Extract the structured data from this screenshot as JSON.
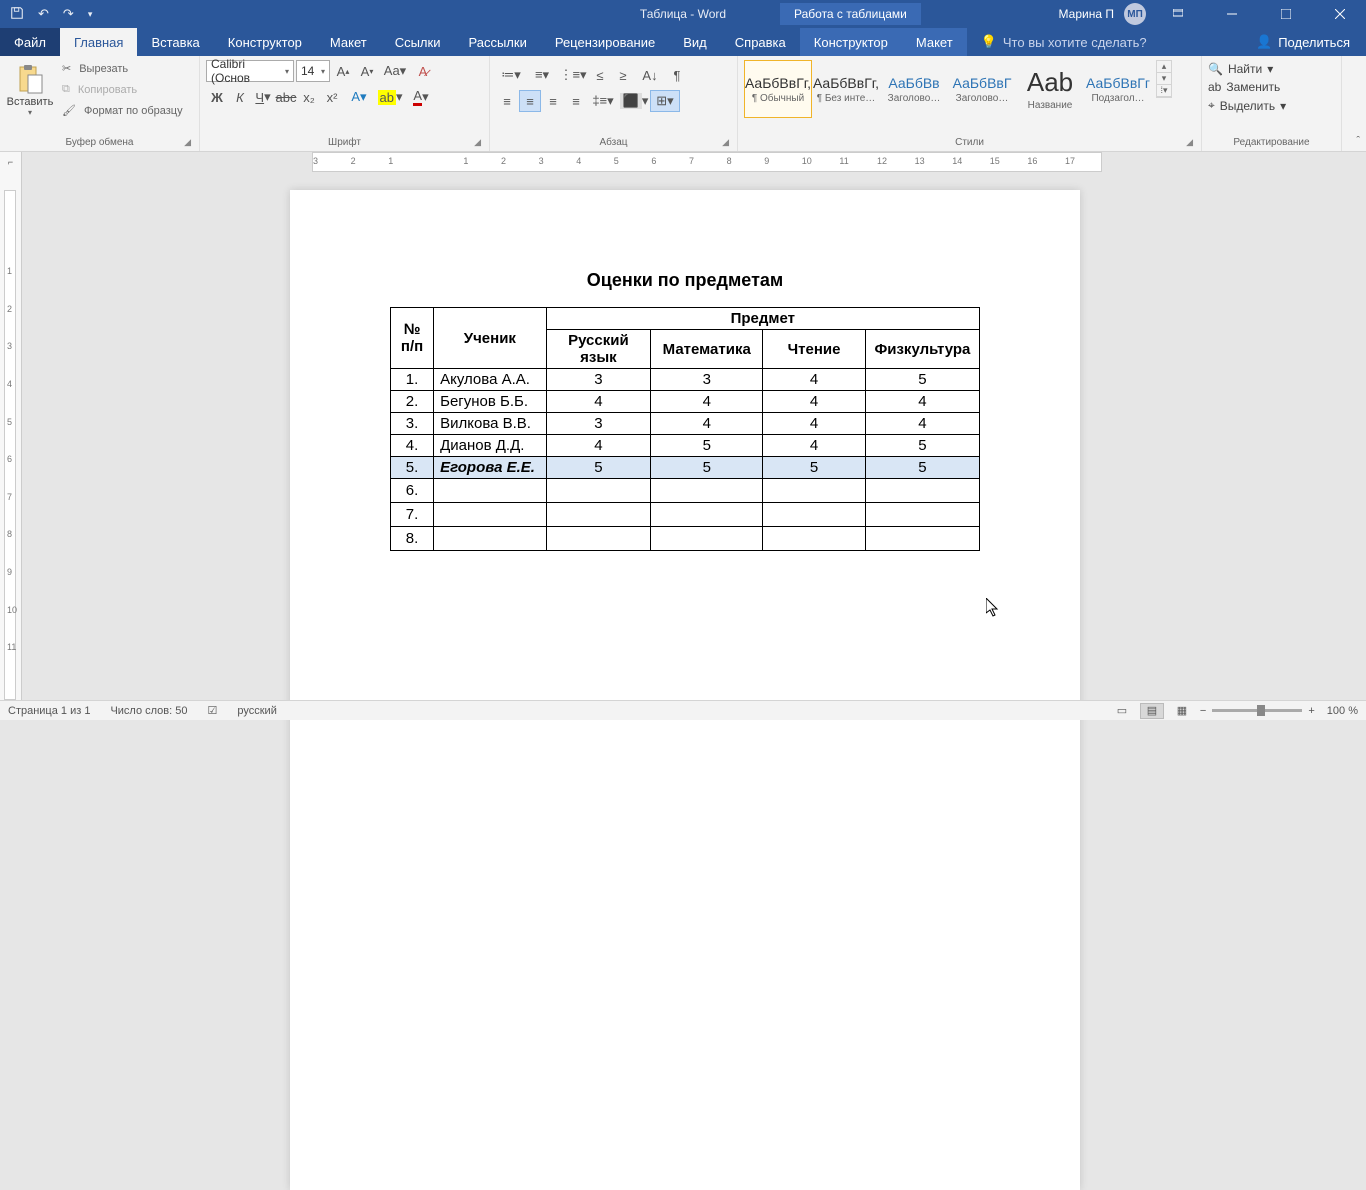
{
  "title": {
    "doc": "Таблица - Word",
    "tableTools": "Работа с таблицами",
    "user": "Марина П",
    "avatar": "МП"
  },
  "tabs": {
    "file": "Файл",
    "home": "Главная",
    "insert": "Вставка",
    "design": "Конструктор",
    "layout": "Макет",
    "references": "Ссылки",
    "mailings": "Рассылки",
    "review": "Рецензирование",
    "view": "Вид",
    "help": "Справка",
    "tableDesign": "Конструктор",
    "tableLayout": "Макет",
    "tellme": "Что вы хотите сделать?",
    "share": "Поделиться"
  },
  "ribbon": {
    "paste": "Вставить",
    "cut": "Вырезать",
    "copy": "Копировать",
    "formatPainter": "Формат по образцу",
    "clipboard": "Буфер обмена",
    "fontName": "Calibri (Основ",
    "fontSize": "14",
    "fontGroup": "Шрифт",
    "paraGroup": "Абзац",
    "styles": [
      {
        "prev": "АаБбВвГг,",
        "label": "¶ Обычный",
        "cls": "sel"
      },
      {
        "prev": "АаБбВвГг,",
        "label": "¶ Без инте…",
        "cls": ""
      },
      {
        "prev": "АаБбВв",
        "label": "Заголово…",
        "cls": "blue"
      },
      {
        "prev": "АаБбВвГ",
        "label": "Заголово…",
        "cls": "blue"
      },
      {
        "prev": "Aab",
        "label": "Название",
        "cls": "big"
      },
      {
        "prev": "АаБбВвГг",
        "label": "Подзагол…",
        "cls": "blue"
      }
    ],
    "stylesGroup": "Стили",
    "find": "Найти",
    "replace": "Заменить",
    "select": "Выделить",
    "editGroup": "Редактирование"
  },
  "doc": {
    "heading": "Оценки по предметам",
    "headers": {
      "num": "№ п/п",
      "student": "Ученик",
      "subject": "Предмет",
      "rus": "Русский язык",
      "math": "Математика",
      "read": "Чтение",
      "pe": "Физкультура"
    },
    "rows": [
      {
        "n": "1.",
        "name": "Акулова А.А.",
        "rus": "3",
        "math": "3",
        "read": "4",
        "pe": "5",
        "hl": false
      },
      {
        "n": "2.",
        "name": "Бегунов Б.Б.",
        "rus": "4",
        "math": "4",
        "read": "4",
        "pe": "4",
        "hl": false
      },
      {
        "n": "3.",
        "name": "Вилкова В.В.",
        "rus": "3",
        "math": "4",
        "read": "4",
        "pe": "4",
        "hl": false
      },
      {
        "n": "4.",
        "name": "Дианов Д.Д.",
        "rus": "4",
        "math": "5",
        "read": "4",
        "pe": "5",
        "hl": false
      },
      {
        "n": "5.",
        "name": "Егорова Е.Е.",
        "rus": "5",
        "math": "5",
        "read": "5",
        "pe": "5",
        "hl": true
      },
      {
        "n": "6.",
        "name": "",
        "rus": "",
        "math": "",
        "read": "",
        "pe": "",
        "hl": false
      },
      {
        "n": "7.",
        "name": "",
        "rus": "",
        "math": "",
        "read": "",
        "pe": "",
        "hl": false
      },
      {
        "n": "8.",
        "name": "",
        "rus": "",
        "math": "",
        "read": "",
        "pe": "",
        "hl": false
      }
    ]
  },
  "status": {
    "page": "Страница 1 из 1",
    "words": "Число слов: 50",
    "lang": "русский",
    "zoom": "100 %"
  },
  "ruler": {
    "h": [
      "3",
      "2",
      "1",
      "",
      "1",
      "2",
      "3",
      "4",
      "5",
      "6",
      "7",
      "8",
      "9",
      "10",
      "11",
      "12",
      "13",
      "14",
      "15",
      "16",
      "17"
    ],
    "v": [
      "",
      "",
      "1",
      "2",
      "3",
      "4",
      "5",
      "6",
      "7",
      "8",
      "9",
      "10",
      "11"
    ]
  }
}
